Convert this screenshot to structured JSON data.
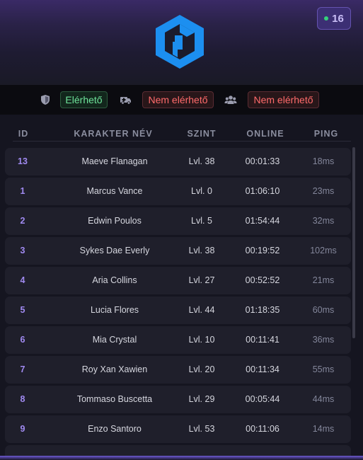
{
  "header": {
    "online_count": "16",
    "logo_icon": "cube-logo-icon",
    "accent_color": "#1e90ff"
  },
  "status": [
    {
      "icon": "shield-icon",
      "label": "Elérhető",
      "state": "available",
      "color": "#6ee39a"
    },
    {
      "icon": "ambulance-icon",
      "label": "Nem elérhető",
      "state": "unavailable",
      "color": "#ff6b6b"
    },
    {
      "icon": "users-icon",
      "label": "Nem elérhető",
      "state": "unavailable",
      "color": "#ff6b6b"
    }
  ],
  "table": {
    "columns": {
      "id": "ID",
      "name": "KARAKTER NÉV",
      "level": "SZINT",
      "online": "ONLINE",
      "ping": "PING"
    },
    "rows": [
      {
        "id": "13",
        "name": "Maeve Flanagan",
        "level": "Lvl. 38",
        "online": "00:01:33",
        "ping": "18ms"
      },
      {
        "id": "1",
        "name": "Marcus Vance",
        "level": "Lvl. 0",
        "online": "01:06:10",
        "ping": "23ms"
      },
      {
        "id": "2",
        "name": "Edwin Poulos",
        "level": "Lvl. 5",
        "online": "01:54:44",
        "ping": "32ms"
      },
      {
        "id": "3",
        "name": "Sykes Dae Everly",
        "level": "Lvl. 38",
        "online": "00:19:52",
        "ping": "102ms"
      },
      {
        "id": "4",
        "name": "Aria Collins",
        "level": "Lvl. 27",
        "online": "00:52:52",
        "ping": "21ms"
      },
      {
        "id": "5",
        "name": "Lucia Flores",
        "level": "Lvl. 44",
        "online": "01:18:35",
        "ping": "60ms"
      },
      {
        "id": "6",
        "name": "Mia Crystal",
        "level": "Lvl. 10",
        "online": "00:11:41",
        "ping": "36ms"
      },
      {
        "id": "7",
        "name": "Roy Xan Xawien",
        "level": "Lvl. 20",
        "online": "00:11:34",
        "ping": "55ms"
      },
      {
        "id": "8",
        "name": "Tommaso Buscetta",
        "level": "Lvl. 29",
        "online": "00:05:44",
        "ping": "44ms"
      },
      {
        "id": "9",
        "name": "Enzo Santoro",
        "level": "Lvl. 53",
        "online": "00:11:06",
        "ping": "14ms"
      }
    ]
  }
}
